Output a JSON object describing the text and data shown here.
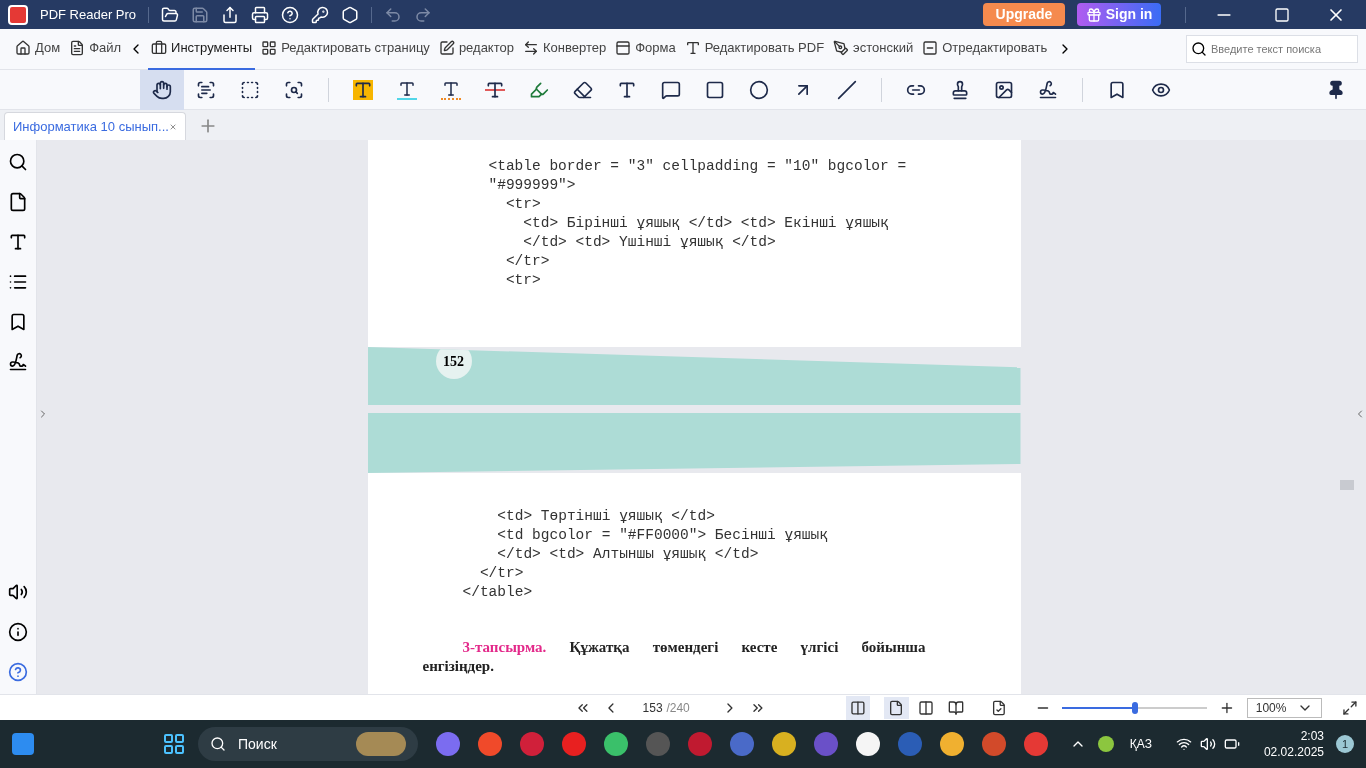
{
  "titlebar": {
    "app_name": "PDF Reader Pro",
    "upgrade": "Upgrade",
    "sign_in": "Sign in"
  },
  "nav_tabs": [
    {
      "label": "Дом",
      "kind": "home",
      "selected": false
    },
    {
      "label": "Файл",
      "kind": "file",
      "selected": false
    },
    {
      "label": "Инструменты",
      "kind": "tools",
      "selected": true
    },
    {
      "label": "Редактировать страницу",
      "kind": "pages",
      "selected": false
    },
    {
      "label": "редактор",
      "kind": "edit",
      "selected": false
    },
    {
      "label": "Конвертер",
      "kind": "convert",
      "selected": false
    },
    {
      "label": "Форма",
      "kind": "form",
      "selected": false
    },
    {
      "label": "Редактировать PDF",
      "kind": "textedit",
      "selected": false
    },
    {
      "label": "эстонский",
      "kind": "pen",
      "selected": false
    },
    {
      "label": "Отредактировать",
      "kind": "redact",
      "selected": false
    }
  ],
  "search": {
    "placeholder": "Введите текст поиска"
  },
  "tools": [
    {
      "kind": "hand",
      "selected": true
    },
    {
      "kind": "select-text",
      "selected": false
    },
    {
      "kind": "area",
      "selected": false
    },
    {
      "kind": "zoom-area",
      "selected": false
    },
    {
      "kind": "highlight",
      "group_start": true,
      "selected": false
    },
    {
      "kind": "underline",
      "selected": false
    },
    {
      "kind": "squiggly",
      "selected": false
    },
    {
      "kind": "strike",
      "selected": false
    },
    {
      "kind": "pencil",
      "selected": false
    },
    {
      "kind": "eraser",
      "selected": false
    },
    {
      "kind": "text",
      "selected": false
    },
    {
      "kind": "note",
      "selected": false
    },
    {
      "kind": "rect",
      "selected": false
    },
    {
      "kind": "circle",
      "selected": false
    },
    {
      "kind": "arrow",
      "selected": false
    },
    {
      "kind": "line",
      "selected": false
    },
    {
      "kind": "link",
      "group_start": true,
      "selected": false
    },
    {
      "kind": "stamp",
      "selected": false
    },
    {
      "kind": "image",
      "selected": false
    },
    {
      "kind": "sign",
      "selected": false
    },
    {
      "kind": "bookmark",
      "group_start": true,
      "selected": false
    },
    {
      "kind": "eye",
      "selected": false
    }
  ],
  "doc_tab": {
    "label": "Информатика 10 сынып...",
    "selected": true
  },
  "page_top": {
    "code": [
      "<table border = \"3\" cellpadding = \"10\" bgcolor =",
      "\"#999999\">",
      "  <tr>",
      "    <td> Бірінші ұяшық </td> <td> Екінші ұяшық",
      "    </td> <td> Үшінші ұяшық </td>",
      "  </tr>",
      "  <tr>"
    ],
    "page_number": "152"
  },
  "page_bottom": {
    "code": [
      "    <td> Төртінші ұяшық </td>",
      "    <td bgcolor = \"#FF0000\"> Бесінші ұяшық",
      "    </td> <td> Алтыншы ұяшық </td>",
      "  </tr>",
      "</table>"
    ],
    "task_label": "3-тапсырма.",
    "task_text": "Құжатқа төмендегі кесте үлгісі бойынша енгізіңдер."
  },
  "status_bar": {
    "page": "153",
    "total": "/240",
    "view_modes": [
      {
        "kind": "single",
        "selected": true
      },
      {
        "kind": "double",
        "selected": false
      },
      {
        "kind": "book",
        "selected": false
      }
    ],
    "zoom": {
      "level": 0.5
    },
    "zoom_text": "100%"
  },
  "taskbar": {
    "search": "Поиск",
    "language": "ҚАЗ",
    "time": "2:03",
    "date": "02.02.2025",
    "notifications": "1"
  }
}
